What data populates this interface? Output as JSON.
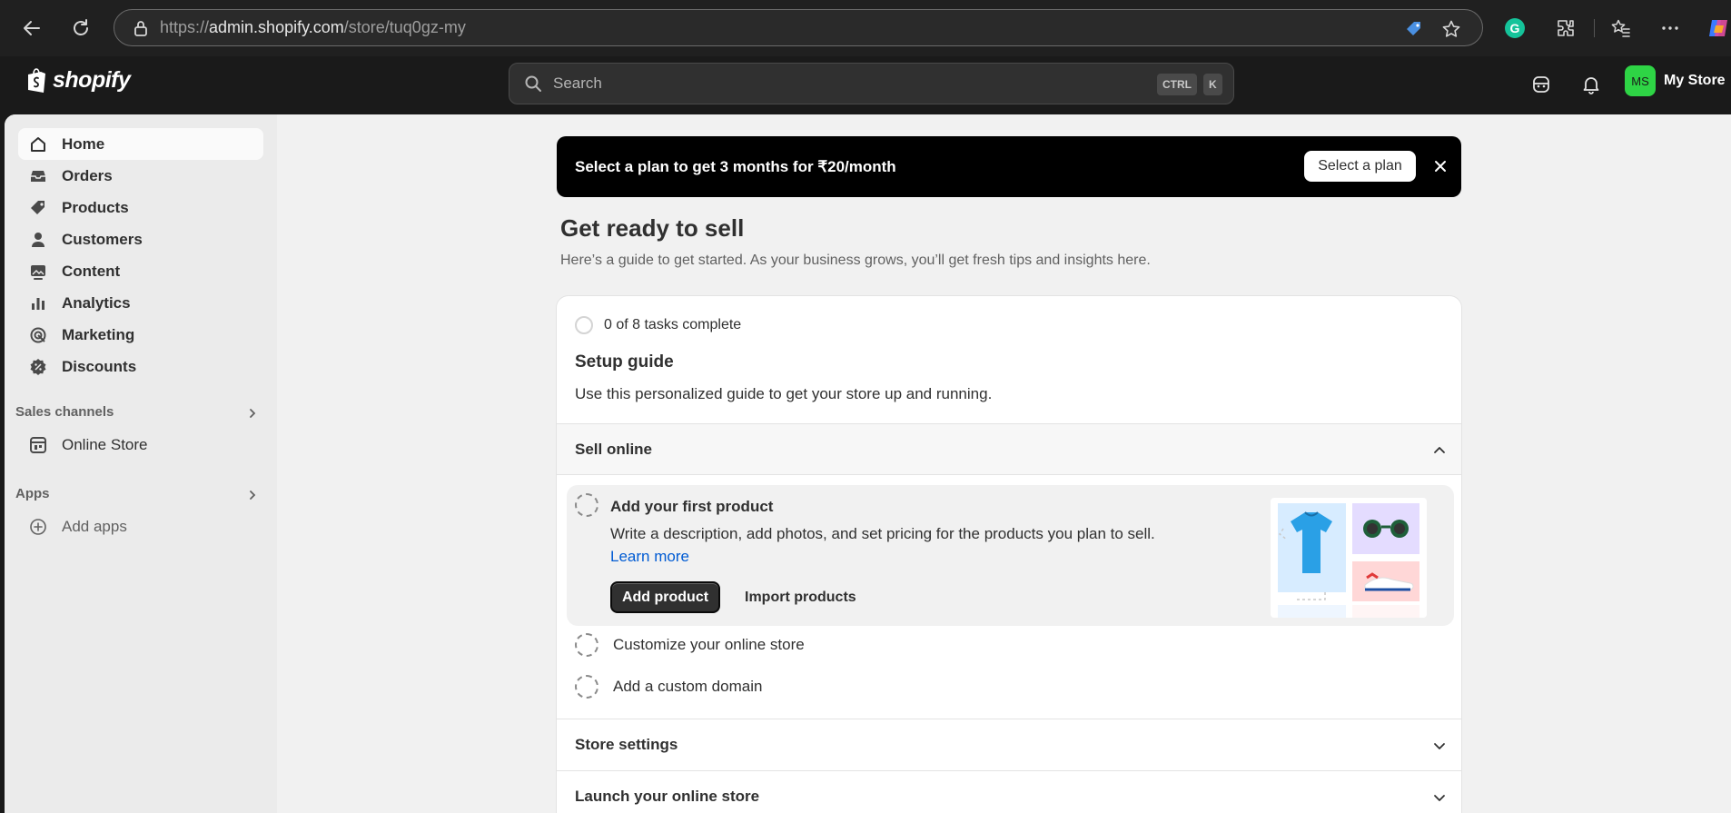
{
  "browser": {
    "url_prefix": "https://",
    "url_host": "admin.shopify.com",
    "url_path": "/store/tuq0gz-my"
  },
  "topbar": {
    "logo_text": "shopify",
    "search_placeholder": "Search",
    "kbd_ctrl": "CTRL",
    "kbd_k": "K",
    "avatar_initials": "MS",
    "store_name": "My Store"
  },
  "sidebar": {
    "items": [
      {
        "label": "Home",
        "icon": "home-icon"
      },
      {
        "label": "Orders",
        "icon": "inbox-icon"
      },
      {
        "label": "Products",
        "icon": "tag-icon"
      },
      {
        "label": "Customers",
        "icon": "person-icon"
      },
      {
        "label": "Content",
        "icon": "image-icon"
      },
      {
        "label": "Analytics",
        "icon": "bar-chart-icon"
      },
      {
        "label": "Marketing",
        "icon": "target-icon"
      },
      {
        "label": "Discounts",
        "icon": "discount-icon"
      }
    ],
    "sales_channels_title": "Sales channels",
    "online_store_label": "Online Store",
    "apps_title": "Apps",
    "add_apps_label": "Add apps"
  },
  "banner": {
    "text": "Select a plan to get 3 months for ₹20/month",
    "button_label": "Select a plan"
  },
  "page": {
    "title": "Get ready to sell",
    "subtitle": "Here’s a guide to get started. As your business grows, you’ll get fresh tips and insights here."
  },
  "setup": {
    "progress": "0 of 8 tasks complete",
    "title": "Setup guide",
    "description": "Use this personalized guide to get your store up and running.",
    "sections": {
      "sell_online": "Sell online",
      "store_settings": "Store settings",
      "launch": "Launch your online store"
    },
    "open_task": {
      "title": "Add your first product",
      "description": "Write a description, add photos, and set pricing for the products you plan to sell.",
      "link": "Learn more",
      "primary_button": "Add product",
      "secondary_button": "Import products"
    },
    "tasks": [
      {
        "label": "Customize your online store"
      },
      {
        "label": "Add a custom domain"
      }
    ]
  },
  "colors": {
    "accent": "#2ed445",
    "link": "#005bd3",
    "banner_bg": "#000000"
  }
}
